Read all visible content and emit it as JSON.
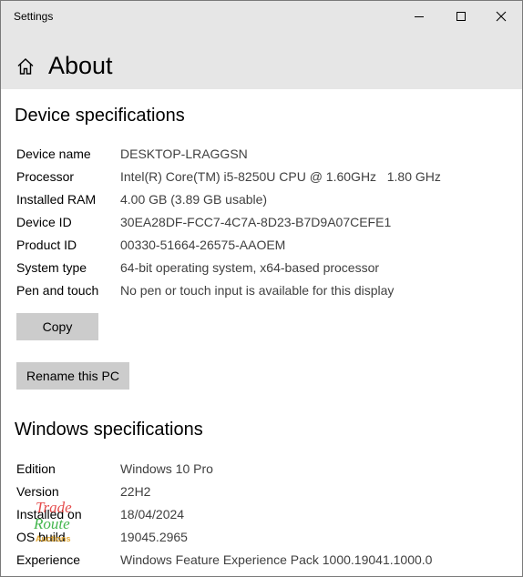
{
  "window": {
    "title": "Settings",
    "minimize_icon": "minimize-icon",
    "maximize_icon": "maximize-icon",
    "close_icon": "close-icon"
  },
  "header": {
    "icon": "home-icon",
    "title": "About"
  },
  "device_specs": {
    "title": "Device specifications",
    "rows": [
      {
        "label": "Device name",
        "value": "DESKTOP-LRAGGSN"
      },
      {
        "label": "Processor",
        "value": "Intel(R) Core(TM) i5-8250U CPU @ 1.60GHz   1.80 GHz"
      },
      {
        "label": "Installed RAM",
        "value": "4.00 GB (3.89 GB usable)"
      },
      {
        "label": "Device ID",
        "value": "30EA28DF-FCC7-4C7A-8D23-B7D9A07CEFE1"
      },
      {
        "label": "Product ID",
        "value": "00330-51664-26575-AAOEM"
      },
      {
        "label": "System type",
        "value": "64-bit operating system, x64-based processor"
      },
      {
        "label": "Pen and touch",
        "value": "No pen or touch input is available for this display"
      }
    ],
    "copy_label": "Copy",
    "rename_label": "Rename this PC"
  },
  "windows_specs": {
    "title": "Windows specifications",
    "rows": [
      {
        "label": "Edition",
        "value": "Windows 10 Pro"
      },
      {
        "label": "Version",
        "value": "22H2"
      },
      {
        "label": "Installed on",
        "value": "18/04/2024"
      },
      {
        "label": "OS build",
        "value": "19045.2965"
      },
      {
        "label": "Experience",
        "value": "Windows Feature Experience Pack 1000.19041.1000.0"
      }
    ]
  },
  "watermark": {
    "line1": "Trade",
    "line2": "Route",
    "line3": "Auctions"
  }
}
